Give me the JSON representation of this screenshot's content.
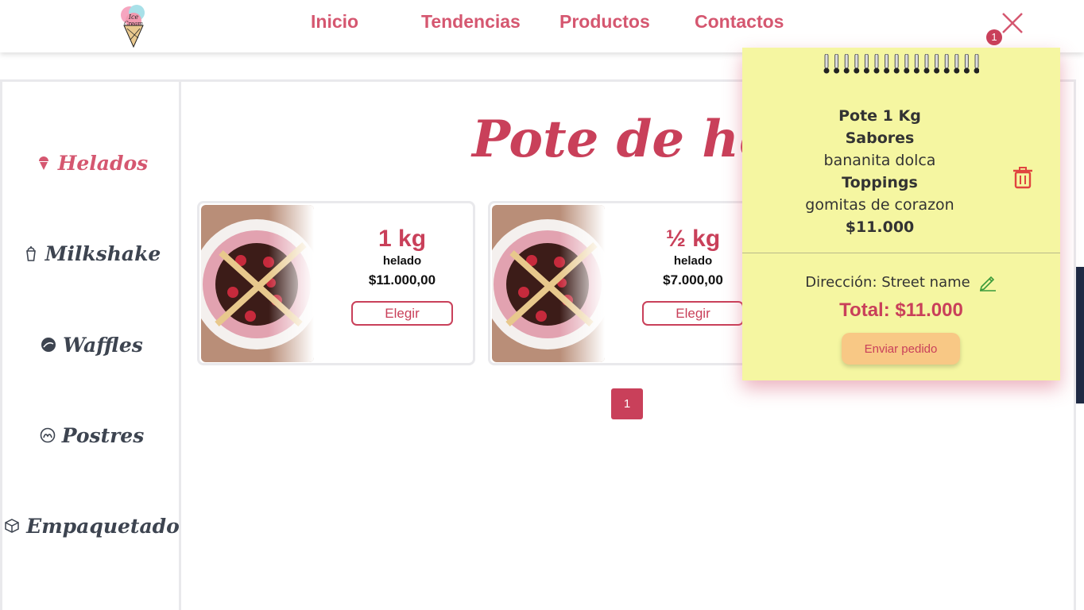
{
  "header": {
    "logo_text": "Ice Cream",
    "nav": [
      {
        "label": "Inicio"
      },
      {
        "label": "Tendencias"
      },
      {
        "label": "Productos"
      },
      {
        "label": "Contactos"
      }
    ],
    "cart_badge_count": "1",
    "close_icon": "close-icon"
  },
  "sidebar": {
    "items": [
      {
        "label": "Helados",
        "icon": "ice-cream-icon",
        "active": true
      },
      {
        "label": "Milkshake",
        "icon": "milkshake-cup-icon",
        "active": false
      },
      {
        "label": "Waffles",
        "icon": "waffle-icon",
        "active": false
      },
      {
        "label": "Postres",
        "icon": "dessert-icon",
        "active": false
      },
      {
        "label": "Empaquetado",
        "icon": "package-icon",
        "active": false
      }
    ]
  },
  "main": {
    "title": "Pote de helado",
    "products": [
      {
        "size": "1 kg",
        "kind": "helado",
        "price": "$11.000,00",
        "button": "Elegir"
      },
      {
        "size": "½ kg",
        "kind": "helado",
        "price": "$7.000,00",
        "button": "Elegir"
      }
    ],
    "pagination": {
      "current_page": "1"
    }
  },
  "cart": {
    "item": {
      "name": "Pote 1 Kg",
      "flavors_label": "Sabores",
      "flavors": "bananita dolca",
      "toppings_label": "Toppings",
      "toppings": "gomitas de corazon",
      "price": "$11.000"
    },
    "address": "Dirección: Street name",
    "total": "Total: $11.000",
    "send_button": "Enviar pedido"
  },
  "colors": {
    "accent": "#c9405a",
    "nav_pink": "#d55770",
    "note_yellow": "#f5f6a1",
    "send_orange": "#f8c885"
  }
}
